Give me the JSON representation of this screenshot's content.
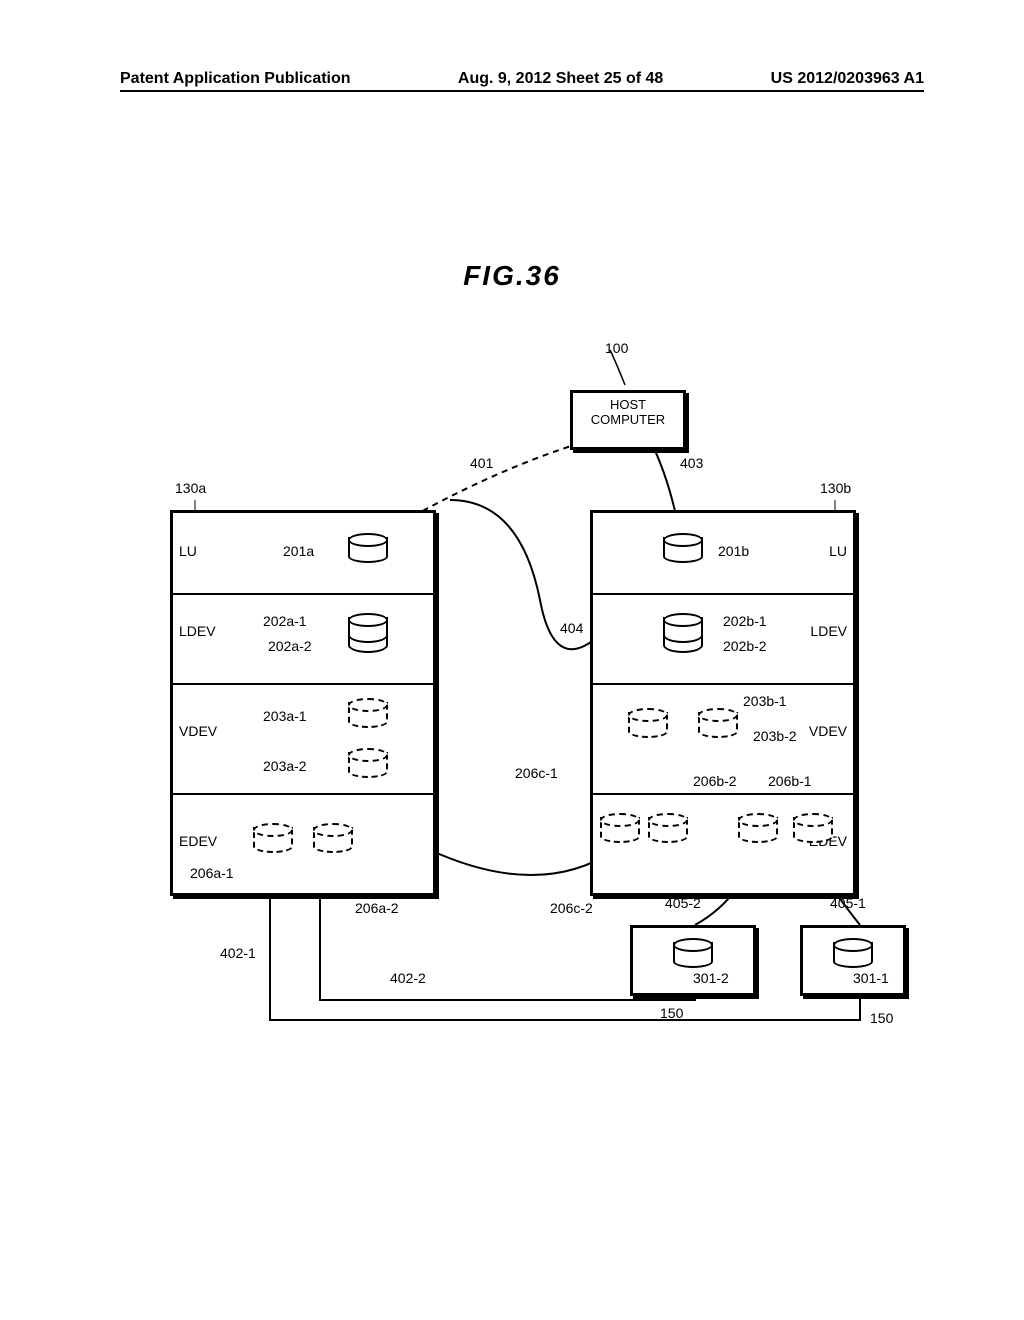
{
  "header": {
    "left": "Patent Application Publication",
    "center": "Aug. 9, 2012  Sheet 25 of 48",
    "right": "US 2012/0203963 A1"
  },
  "figure": {
    "title": "FIG.36",
    "host": {
      "ref": "100",
      "label": "HOST\nCOMPUTER"
    },
    "path_refs": {
      "a": "401",
      "b": "403",
      "c": "404"
    },
    "storage_a": {
      "ref": "130a",
      "rows": {
        "lu": "LU",
        "ldev": "LDEV",
        "vdev": "VDEV",
        "edev": "EDEV"
      },
      "labels": {
        "lu_cyl": "201a",
        "ldev1": "202a-1",
        "ldev2": "202a-2",
        "vdev1": "203a-1",
        "vdev2": "203a-2",
        "edev1": "206a-1",
        "edev2": "206a-2"
      }
    },
    "storage_b": {
      "ref": "130b",
      "rows": {
        "lu": "LU",
        "ldev": "LDEV",
        "vdev": "VDEV",
        "edev": "EDEV"
      },
      "labels": {
        "lu_cyl": "201b",
        "ldev1": "202b-1",
        "ldev2": "202b-2",
        "vdev1": "203b-1",
        "vdev2": "203b-2",
        "edev_c1": "206c-1",
        "edev_c2": "206c-2",
        "edev_b1": "206b-1",
        "edev_b2": "206b-2"
      }
    },
    "bottom": {
      "left_paths": {
        "p1": "402-1",
        "p2": "402-2"
      },
      "right_paths": {
        "p1": "405-1",
        "p2": "405-2"
      },
      "ext_boxes": {
        "e1_ref": "150",
        "e1_cyl": "301-2",
        "e2_ref": "150",
        "e2_cyl": "301-1"
      }
    }
  }
}
